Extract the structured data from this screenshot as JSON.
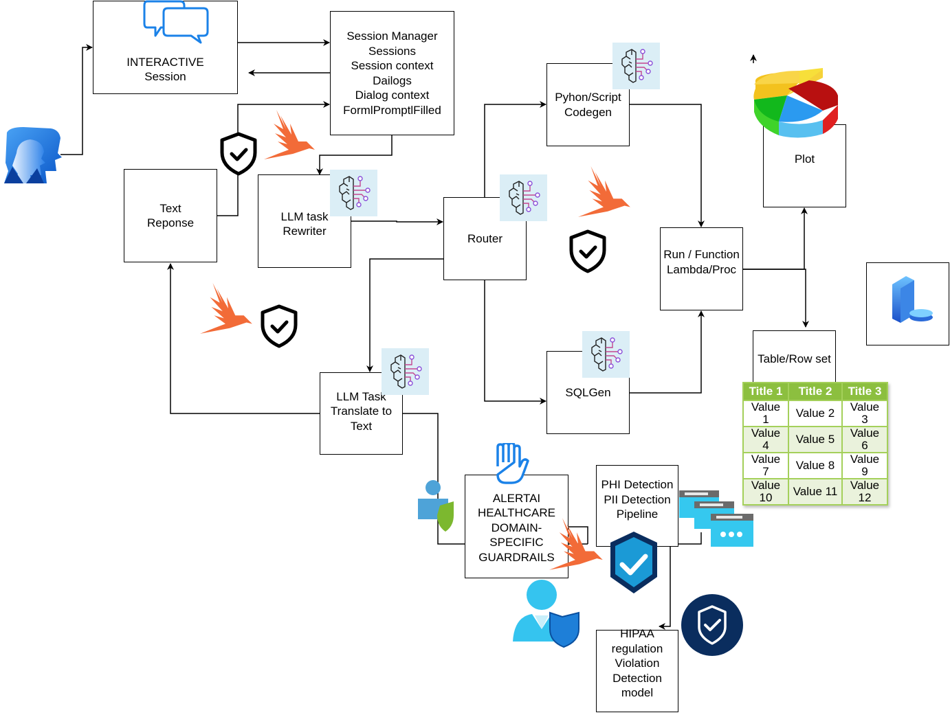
{
  "diagram": {
    "nodes": {
      "interactive_session": {
        "label": "INTERACTIVE\nSession",
        "icon": "chat-bubbles-icon"
      },
      "session_manager": {
        "label": "Session Manager\nSessions\nSession context\nDailogs\nDialog context\nFormlPromptlFilled"
      },
      "text_response": {
        "label": "Text\nReponse"
      },
      "llm_rewriter": {
        "label": "LLM task\nRewriter",
        "icon": "ai-brain-icon"
      },
      "router": {
        "label": "Router",
        "icon": "ai-brain-icon"
      },
      "python_codegen": {
        "label": "Pyhon/Script\nCodegen",
        "icon": "ai-brain-icon"
      },
      "sqlgen": {
        "label": "SQLGen",
        "icon": "ai-brain-icon"
      },
      "run_function": {
        "label": "Run / Function\nLambda/Proc"
      },
      "plot": {
        "label": "Plot",
        "icon": "3d-pie-chart-icon"
      },
      "table_rowset": {
        "label": "Table/Row set"
      },
      "llm_translate": {
        "label": "LLM Task\nTranslate to\nText",
        "icon": "ai-brain-icon"
      },
      "guardrails": {
        "label": "ALERTAI\nHEALTHCARE\nDOMAIN-\nSPECIFIC\nGUARDRAILS",
        "icon": "raised-hand-icon"
      },
      "phi_pipeline": {
        "label": "PHI Detection\nPII Detection\nPipeline"
      },
      "hipaa_model": {
        "label": "HIPAA\nregulation\nViolation\nDetection\nmodel"
      },
      "database_server": {
        "label": "",
        "icon": "server-database-icon"
      }
    },
    "table": {
      "headers": [
        "Title 1",
        "Title 2",
        "Title 3"
      ],
      "rows": [
        [
          "Value 1",
          "Value 2",
          "Value 3"
        ],
        [
          "Value 4",
          "Value 5",
          "Value 6"
        ],
        [
          "Value 7",
          "Value 8",
          "Value 9"
        ],
        [
          "Value 10",
          "Value 11",
          "Value 12"
        ]
      ]
    },
    "edges": [
      {
        "from": "users",
        "to": "interactive_session"
      },
      {
        "from": "interactive_session",
        "to": "session_manager"
      },
      {
        "from": "session_manager",
        "to": "interactive_session"
      },
      {
        "from": "text_response",
        "to": "session_manager"
      },
      {
        "from": "session_manager",
        "to": "llm_rewriter"
      },
      {
        "from": "llm_rewriter",
        "to": "router"
      },
      {
        "from": "router",
        "to": "python_codegen"
      },
      {
        "from": "router",
        "to": "sqlgen"
      },
      {
        "from": "router",
        "to": "llm_translate"
      },
      {
        "from": "python_codegen",
        "to": "run_function"
      },
      {
        "from": "sqlgen",
        "to": "run_function"
      },
      {
        "from": "run_function",
        "to": "plot"
      },
      {
        "from": "run_function",
        "to": "table_rowset"
      },
      {
        "from": "llm_translate",
        "to": "text_response"
      },
      {
        "from": "llm_translate",
        "to": "guardrails"
      },
      {
        "from": "phi_pipeline",
        "to": "guardrails"
      },
      {
        "from": "phi_pipeline",
        "to": "hipaa_model"
      }
    ],
    "decorations": [
      "users-group-icon",
      "shield-check-icon",
      "orange-bird-logo-icon",
      "user-shield-icon",
      "hexagon-check-shield-icon",
      "circle-shield-check-icon",
      "browser-windows-icon"
    ],
    "colors": {
      "line": "#000000",
      "ai_badge_bg": "#dbeef6",
      "bird": "#f26b38",
      "table_header": "#8cbf3f",
      "table_border": "#a4d05a",
      "table_alt_row": "#eaf2dc",
      "navy": "#0a2d5e",
      "azure": "#1b9ad6"
    }
  }
}
